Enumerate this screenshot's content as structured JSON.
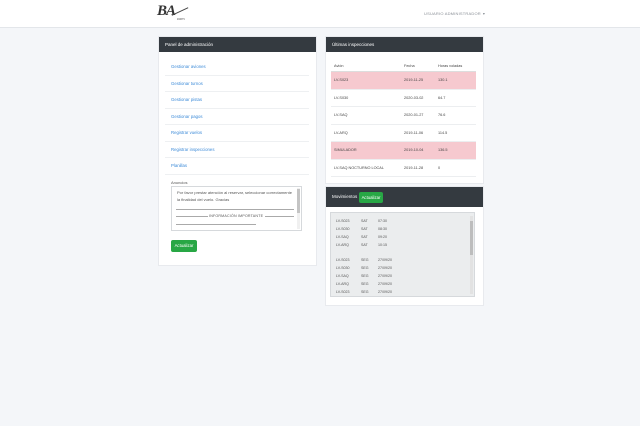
{
  "header": {
    "logo_text": "BA",
    "logo_sub": "com",
    "user_menu": "USUARIO ADMINISTRADOR"
  },
  "admin_panel": {
    "title": "Panel de administración",
    "menu": [
      "Gestionar aviones",
      "Gestionar turnos",
      "Gestionar pistas",
      "Gestionar pagos",
      "Registrar vuelos",
      "Registrar inspecciones",
      "Planillas"
    ],
    "textarea_label": "Anuncios",
    "textarea_text": "Por favor prestar atención al reservar, seleccionar correctamente la finalidad del vuelo. Gracias",
    "textarea_warning": "INFORMACIÓN IMPORTANTE",
    "update_button": "Actualizar"
  },
  "inspections": {
    "title": "Últimas inspecciones",
    "columns": [
      "Avión",
      "Fecha",
      "Horas voladas"
    ],
    "rows": [
      {
        "avion": "LV-S023",
        "fecha": "2019-11-25",
        "horas": "130.1",
        "alert": true
      },
      {
        "avion": "LV-S030",
        "fecha": "2020-03-02",
        "horas": "64.7",
        "alert": false
      },
      {
        "avion": "LV-SAQ",
        "fecha": "2020-01-27",
        "horas": "76.6",
        "alert": false
      },
      {
        "avion": "LV-ARQ",
        "fecha": "2019-11-06",
        "horas": "114.5",
        "alert": false
      },
      {
        "avion": "SIMULADOR",
        "fecha": "2019-10-04",
        "horas": "136.5",
        "alert": true
      },
      {
        "avion": "LV-SAQ NOCTURNO LOCAL",
        "fecha": "2019-11-28",
        "horas": "0",
        "alert": false
      }
    ]
  },
  "movements": {
    "title": "Movimientos",
    "update_button": "Actualizar",
    "log": [
      {
        "avion": "LV-S023",
        "tipo": "SAT",
        "hora": "07:30"
      },
      {
        "avion": "LV-S030",
        "tipo": "SAT",
        "hora": "08:30"
      },
      {
        "avion": "LV-SAQ",
        "tipo": "SAT",
        "hora": "09:20"
      },
      {
        "avion": "LV-ARQ",
        "tipo": "SAT",
        "hora": "10:15"
      },
      {
        "avion": "LV-S023",
        "tipo": "SEG",
        "hora": "27/09/20"
      },
      {
        "avion": "LV-S030",
        "tipo": "SEG",
        "hora": "27/09/20"
      },
      {
        "avion": "LV-SAQ",
        "tipo": "SEG",
        "hora": "27/09/20"
      },
      {
        "avion": "LV-ARQ",
        "tipo": "SEG",
        "hora": "27/09/20"
      },
      {
        "avion": "LV-S023",
        "tipo": "SEG",
        "hora": "27/09/20"
      }
    ]
  },
  "colors": {
    "header_dark": "#343a40",
    "link_blue": "#3d8bd8",
    "alert_row": "#f6c9cf",
    "button_green": "#28a745"
  }
}
